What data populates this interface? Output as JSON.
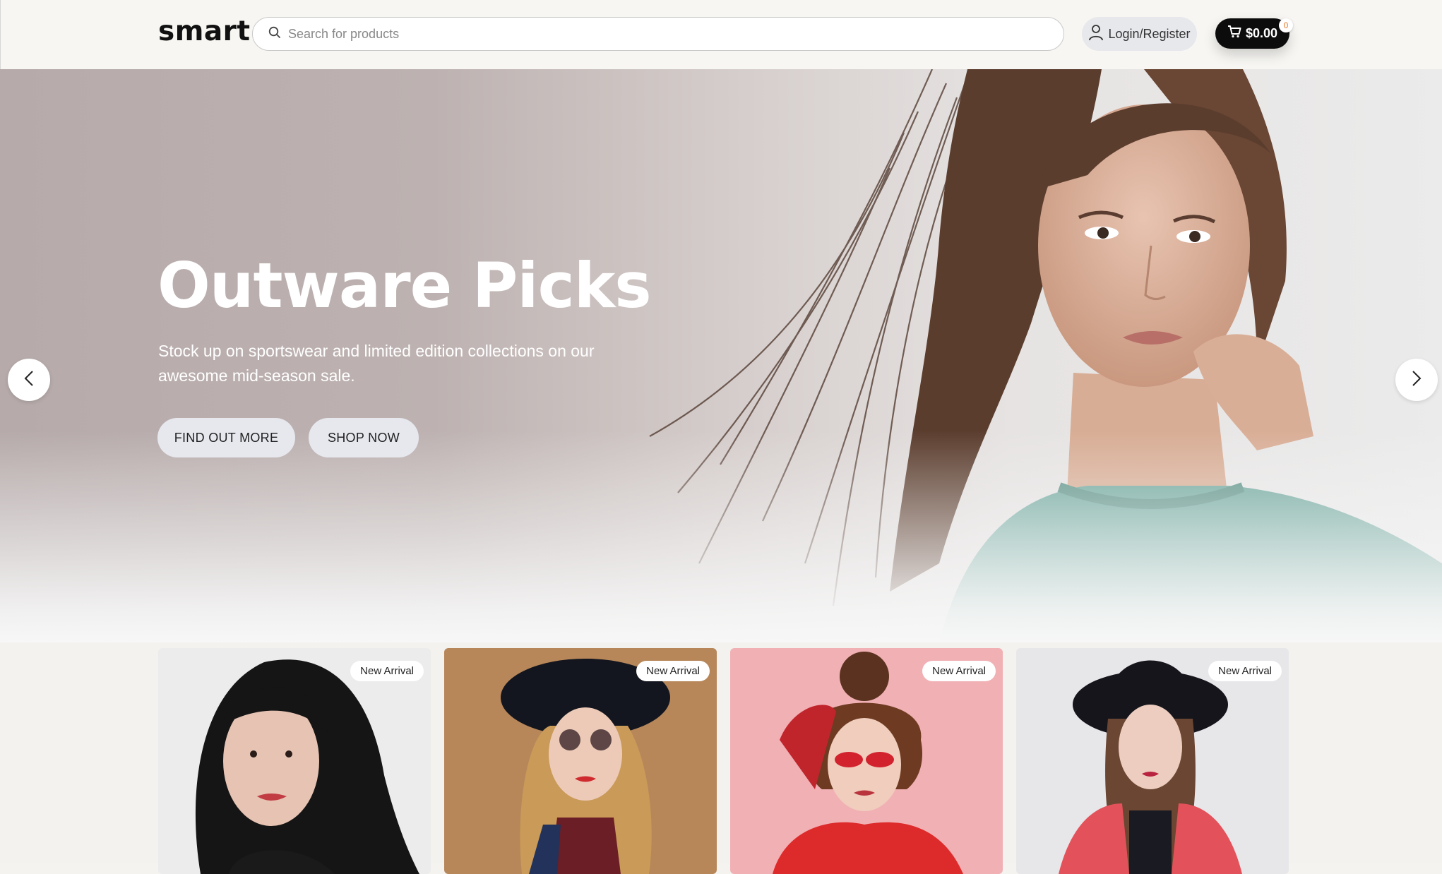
{
  "header": {
    "logo": "smart.",
    "search_placeholder": "Search for products",
    "login_label": "Login/Register",
    "cart_total": "$0.00",
    "cart_count": "0"
  },
  "hero": {
    "title": "Outware Picks",
    "subtitle": "Stock up on sportswear and limited edition collections on our awesome mid-season sale.",
    "buttons": [
      "FIND OUT MORE",
      "SHOP NOW"
    ]
  },
  "products": [
    {
      "badge": "New Arrival",
      "bg": "#ececec"
    },
    {
      "badge": "New Arrival",
      "bg": "#b7875a"
    },
    {
      "badge": "New Arrival",
      "bg": "#f1b0b4"
    },
    {
      "badge": "New Arrival",
      "bg": "#e7e6e9"
    }
  ],
  "colors": {
    "accent": "#0c0c0c",
    "button_bg": "#e6e8ee",
    "badge_text": "#e07a2a"
  }
}
